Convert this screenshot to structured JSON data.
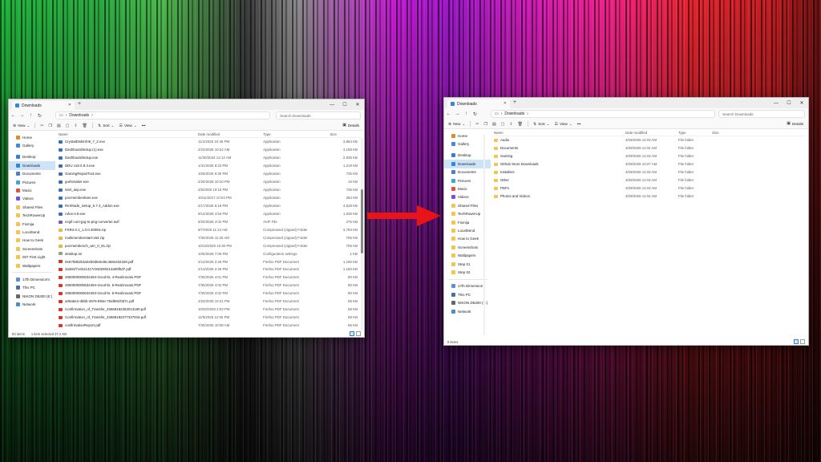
{
  "left_window": {
    "tab_title": "Downloads",
    "path": "Downloads",
    "search_placeholder": "Search Downloads",
    "toolbar": {
      "new": "New",
      "sort": "Sort",
      "view": "View",
      "more": "•••",
      "details": "Details"
    },
    "columns": {
      "name": "Name",
      "date": "Date modified",
      "type": "Type",
      "size": "Size"
    },
    "sidebar": [
      "Home",
      "Gallery",
      "Desktop",
      "Downloads",
      "Documents",
      "Pictures",
      "Music",
      "Videos",
      "Shared Files",
      "TechRowerUp",
      "Fixmija",
      "LocalSend",
      "How to Geek",
      "Screenshots",
      "007 First Light",
      "Wallpapers",
      "17th Dimension's",
      "This PC",
      "NIKON D5300 (E:)",
      "Network"
    ],
    "rows": [
      {
        "name": "CrystalDiskInfo9_7_2.exe",
        "date": "11/1/2025 10:46 PM",
        "type": "Application",
        "size": "3,884 KB"
      },
      {
        "name": "DashboardSetup (1).exe",
        "date": "2/23/2025 10:22 AM",
        "type": "Application",
        "size": "3,158 KB"
      },
      {
        "name": "DashboardSetup.exe",
        "date": "11/30/2024 12:12 AM",
        "type": "Application",
        "size": "2,935 KB"
      },
      {
        "name": "DDU v18.0.9.3.exe",
        "date": "1/31/2025 8:23 PM",
        "type": "Application",
        "size": "1,219 KB"
      },
      {
        "name": "GamingRepairTool.exe",
        "date": "10/6/2025 6:30 PM",
        "type": "Application",
        "size": "735 KB"
      },
      {
        "name": "gurlsmaker.exe",
        "date": "2/20/2025 10:10 PM",
        "type": "Application",
        "size": "16 KB"
      },
      {
        "name": "intel_aep.exe",
        "date": "2/5/2025 10:15 PM",
        "type": "Application",
        "size": "735 KB"
      },
      {
        "name": "pocmembeshare.exe",
        "date": "10/11/2017 10:04 PM",
        "type": "Application",
        "size": "284 KB"
      },
      {
        "name": "ReShade_Setup_6.7.3_Addon.exe",
        "date": "2/17/2026 6:19 PM",
        "type": "Application",
        "size": "4,529 KB"
      },
      {
        "name": "rufus-4.9.exe",
        "date": "9/14/2025 4:53 PM",
        "type": "Application",
        "size": "1,935 KB"
      },
      {
        "name": "ezgif.com-jpg-to-png-converter.avif",
        "date": "5/20/2025 4:02 PM",
        "type": "AVIF File",
        "size": "275 KB"
      },
      {
        "name": "FSR4.0.1_1.0.0.40094.zip",
        "date": "9/7/2025 11:13 AM",
        "type": "Compressed (zipped) Folder",
        "size": "3,793 KB"
      },
      {
        "name": "multimemberstart-x64.zip",
        "date": "7/30/2025 11:20 AM",
        "type": "Compressed (zipped) Folder",
        "size": "705 KB"
      },
      {
        "name": "pocmembench_win_0_91.zip",
        "date": "10/16/2025 10:30 PM",
        "type": "Compressed (zipped) Folder",
        "size": "705 KB"
      },
      {
        "name": "desktop.ini",
        "date": "10/6/2025 7:06 PM",
        "type": "Configuration settings",
        "size": "1 KB"
      },
      {
        "name": "0e6708b2b3a04b0d84e35c4684434330.pdf",
        "date": "2/13/2026 2:26 PM",
        "type": "Firefox PDF Document",
        "size": "1,180 KB"
      },
      {
        "name": "3a381f7ceb21417c940280414a05f0d7.pdf",
        "date": "2/13/2026 2:26 PM",
        "type": "Firefox PDF Document",
        "size": "1,180 KB"
      },
      {
        "name": "2650000000634494-Izvod-br. 4-Realizovani.PDF",
        "date": "7/30/2025 4:01 PM",
        "type": "Firefox PDF Document",
        "size": "80 KB"
      },
      {
        "name": "2650000000634494-Izvod-br. 5-Realizovani.PDF",
        "date": "7/30/2025 4:02 PM",
        "type": "Firefox PDF Document",
        "size": "80 KB"
      },
      {
        "name": "2650000000634494-Izvod-br. 6-Realizovani.PDF",
        "date": "7/30/2025 4:02 PM",
        "type": "Firefox PDF Document",
        "size": "80 KB"
      },
      {
        "name": "a05a5e2-d5bb-4576-893e-75af691f0d7c.pdf",
        "date": "2/23/2025 10:41 PM",
        "type": "Firefox PDF Document",
        "size": "59 KB"
      },
      {
        "name": "Confirmation_of_Transfer_43668182252013190.pdf",
        "date": "10/20/2025 2:03 PM",
        "type": "Firefox PDF Document",
        "size": "59 KB"
      },
      {
        "name": "Confirmation_of_Transfer_43668182277327815.pdf",
        "date": "11/5/2025 12:05 PM",
        "type": "Firefox PDF Document",
        "size": "59 KB"
      },
      {
        "name": "confirmationReport.pdf",
        "date": "7/30/2025 10:08 AM",
        "type": "Firefox PDF Document",
        "size": "66 KB"
      }
    ],
    "status": {
      "count": "83 items",
      "selected": "1 item selected  37.2 KB"
    }
  },
  "right_window": {
    "tab_title": "Downloads",
    "path": "Downloads",
    "search_placeholder": "Search Downloads",
    "toolbar": {
      "new": "New",
      "sort": "Sort",
      "view": "View",
      "more": "•••",
      "details": "Details"
    },
    "columns": {
      "name": "Name",
      "date": "Date modified",
      "type": "Type",
      "size": "Size"
    },
    "sidebar": [
      "Home",
      "Gallery",
      "Desktop",
      "Downloads",
      "Documents",
      "Pictures",
      "Music",
      "Videos",
      "Shared Files",
      "TechRowerUp",
      "Fixmija",
      "LocalSend",
      "How to Geek",
      "Screenshots",
      "Wallpapers",
      "Step 01",
      "Step 02",
      "17th Dimension",
      "This PC",
      "NIKON D5300 (E:)",
      "Network"
    ],
    "rows": [
      {
        "name": "Audio",
        "date": "3/29/2026 11:03 AM",
        "type": "File folder"
      },
      {
        "name": "Documents",
        "date": "3/29/2026 11:02 AM",
        "type": "File folder"
      },
      {
        "name": "Gaming",
        "date": "3/29/2026 11:03 AM",
        "type": "File folder"
      },
      {
        "name": "Github Store Downloads",
        "date": "3/29/2026 10:27 AM",
        "type": "File folder"
      },
      {
        "name": "Installers",
        "date": "3/29/2026 11:03 AM",
        "type": "File folder"
      },
      {
        "name": "Other",
        "date": "3/29/2026 11:03 AM",
        "type": "File folder"
      },
      {
        "name": "PDFs",
        "date": "3/29/2026 11:03 AM",
        "type": "File folder"
      },
      {
        "name": "Photos and Videos",
        "date": "3/29/2026 11:04 AM",
        "type": "File folder"
      }
    ],
    "status": {
      "count": "8 items"
    }
  },
  "colors": {
    "arrow": "#e8141a",
    "selection": "#cde3f7",
    "folder": "#f4c54c"
  },
  "icons": {
    "arrow": "right-arrow-icon"
  }
}
